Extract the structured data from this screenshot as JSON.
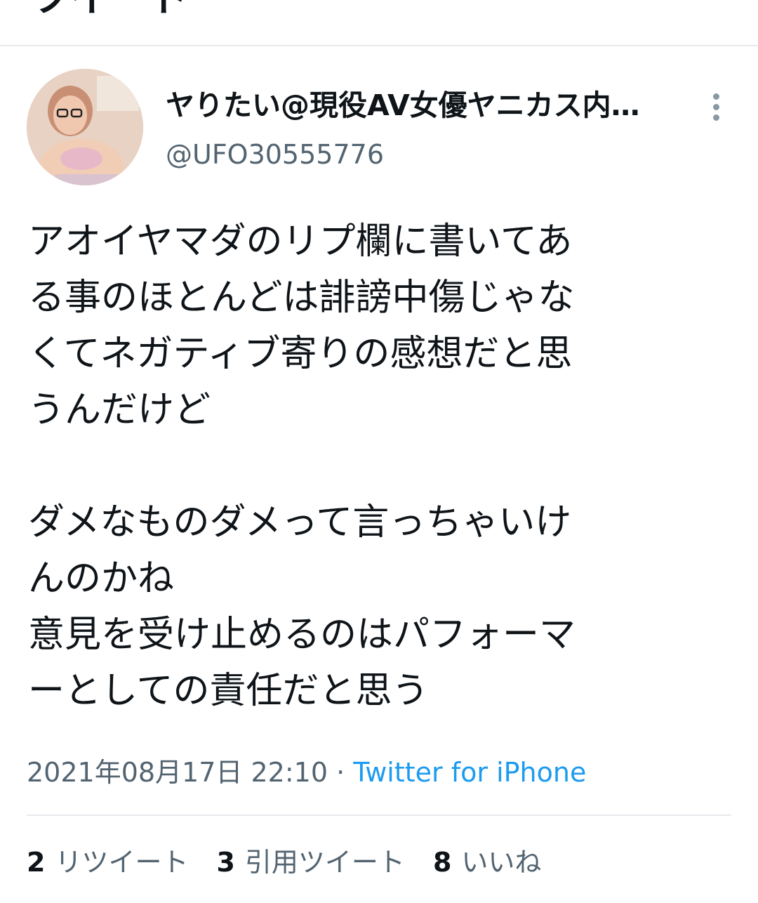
{
  "tweet": {
    "author": {
      "display_name": "ヤりたい@現役AV女優ヤニカス内…",
      "handle": "@UFO30555776"
    },
    "body": {
      "paragraph_1": [
        "アオイヤマダのリプ欄に書いてあ",
        "る事のほとんどは誹謗中傷じゃな",
        "くてネガティブ寄りの感想だと思",
        "うんだけど"
      ],
      "paragraph_2": [
        "ダメなものダメって言っちゃいけ",
        "んのかね",
        "意見を受け止めるのはパフォーマ",
        "ーとしての責任だと思う"
      ]
    },
    "timestamp": "2021年08月17日 22:10",
    "separator": "·",
    "source": "Twitter for iPhone",
    "stats": [
      {
        "count": "2",
        "label": "リツイート"
      },
      {
        "count": "3",
        "label": "引用ツイート"
      },
      {
        "count": "8",
        "label": "いいね"
      }
    ]
  },
  "colors": {
    "text_primary": "#0f1419",
    "text_secondary": "#536471",
    "link": "#1d9bf0",
    "divider": "#e6e9ec"
  },
  "icons": {
    "more": "more-vertical-icon"
  }
}
